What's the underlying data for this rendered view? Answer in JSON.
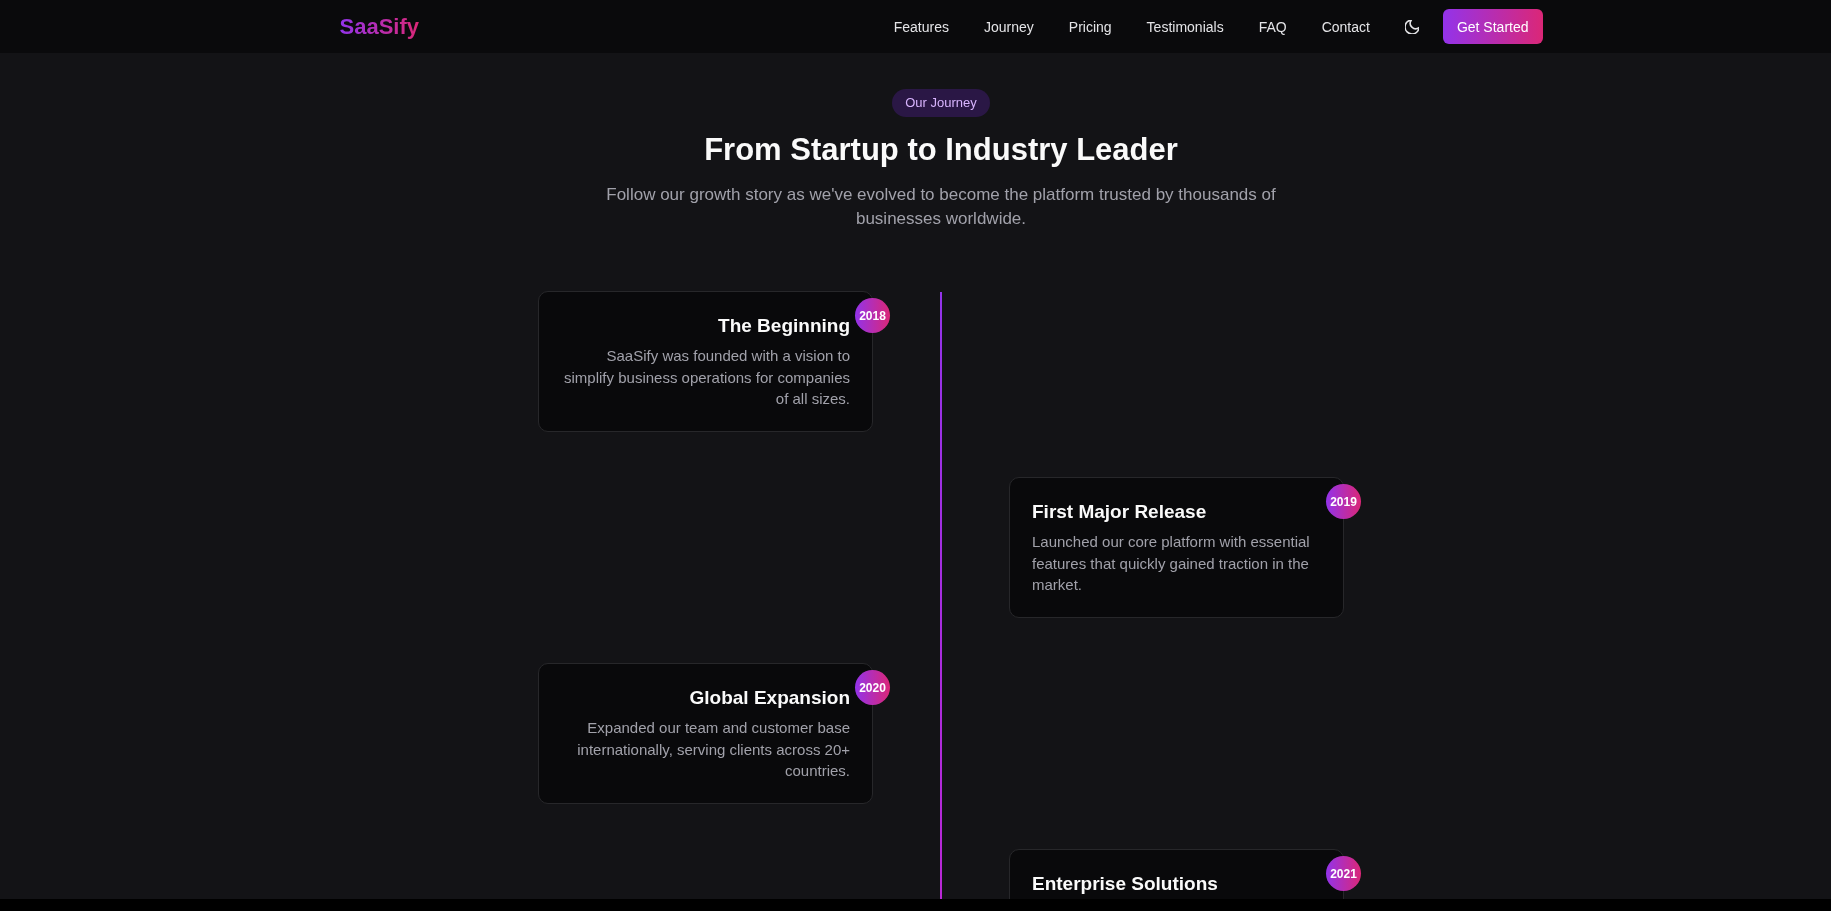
{
  "nav": {
    "logo": "SaaSify",
    "links": [
      "Features",
      "Journey",
      "Pricing",
      "Testimonials",
      "FAQ",
      "Contact"
    ],
    "button": "Get Started"
  },
  "hero": {
    "badge": "Our Journey",
    "title": "From Startup to Industry Leader",
    "subtitle": "Follow our growth story as we've evolved to become the platform trusted by thousands of businesses worldwide."
  },
  "timeline": [
    {
      "year": "2018",
      "title": "The Beginning",
      "description": "SaaSify was founded with a vision to simplify business operations for companies of all sizes."
    },
    {
      "year": "2019",
      "title": "First Major Release",
      "description": "Launched our core platform with essential features that quickly gained traction in the market."
    },
    {
      "year": "2020",
      "title": "Global Expansion",
      "description": "Expanded our team and customer base internationally, serving clients across 20+ countries."
    },
    {
      "year": "2021",
      "title": "Enterprise Solutions"
    }
  ]
}
